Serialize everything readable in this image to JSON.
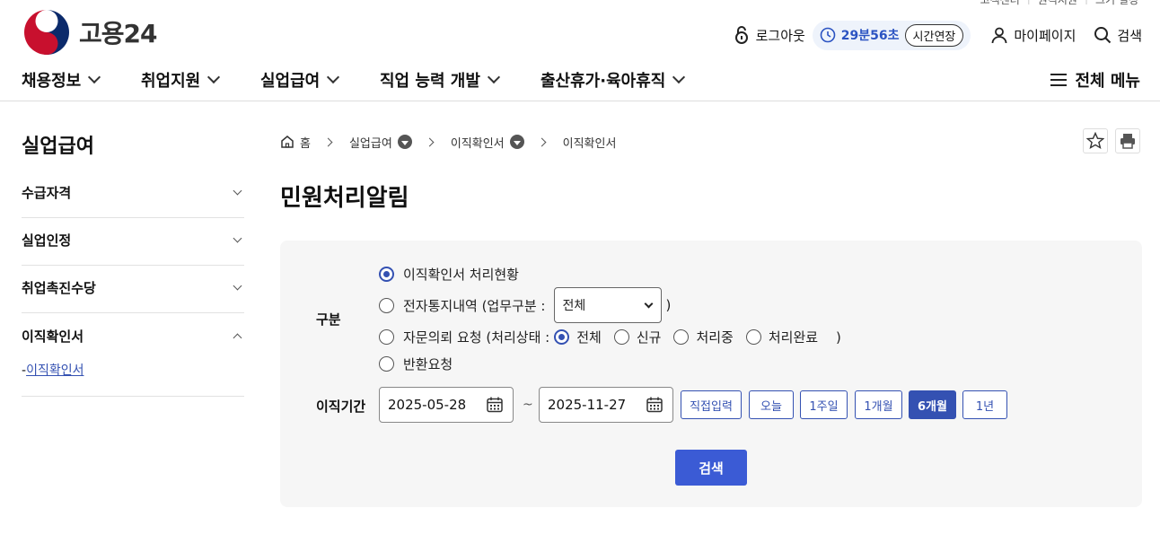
{
  "util_links": [
    "고객센터",
    "원격지원",
    "크기 설정"
  ],
  "logo": {
    "text": "고용24"
  },
  "header": {
    "logout": "로그아웃",
    "timer": "29분56초",
    "extend": "시간연장",
    "mypage": "마이페이지",
    "search": "검색"
  },
  "gnb": [
    "채용정보",
    "취업지원",
    "실업급여",
    "직업 능력 개발",
    "출산휴가·육아휴직"
  ],
  "all_menu": "전체 메뉴",
  "sidebar": {
    "title": "실업급여",
    "items": [
      "수급자격",
      "실업인정",
      "취업촉진수당",
      "이직확인서"
    ],
    "sub_prefix": "-",
    "sub_item": "이직확인서"
  },
  "breadcrumb": [
    "홈",
    "실업급여",
    "이직확인서",
    "이직확인서"
  ],
  "page_title": "민원처리알림",
  "form": {
    "category_label": "구분",
    "options": {
      "opt1": "이직확인서 처리현황",
      "opt2": "전자통지내역 (업무구분 :",
      "opt2_close": ")",
      "select_value": "전체",
      "opt3": "자문의뢰 요청 (처리상태 :",
      "opt3_close": ")",
      "status_options": [
        "전체",
        "신규",
        "처리중",
        "처리완료"
      ],
      "opt4": "반환요청"
    },
    "period_label": "이직기간",
    "date_from": "2025-05-28",
    "tilde": "~",
    "date_to": "2025-11-27",
    "period_buttons": [
      "직접입력",
      "오늘",
      "1주일",
      "1개월",
      "6개월",
      "1년"
    ],
    "search_button": "검색"
  },
  "colors": {
    "accent": "#3451b2",
    "search_button": "#3b5bd5",
    "panel": "#f6f6f6"
  }
}
